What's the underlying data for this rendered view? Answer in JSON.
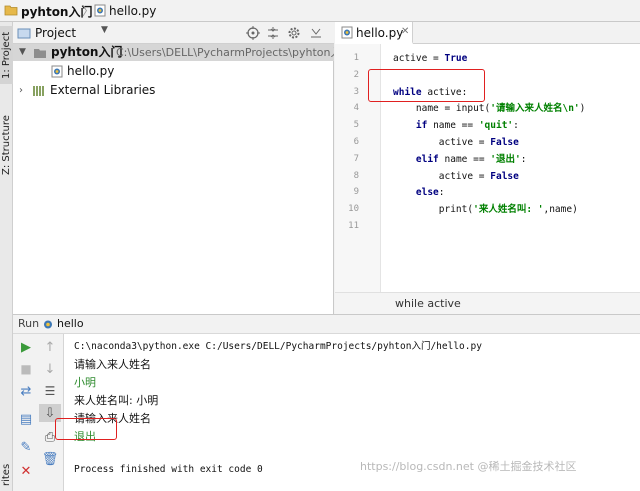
{
  "nav": {
    "project": "pyhton入门",
    "file": "hello.py"
  },
  "side_tabs": {
    "project": "1: Project",
    "structure": "Z: Structure",
    "favorites": "rites"
  },
  "project_panel": {
    "title": "Project",
    "root": {
      "name": "pyhton入门",
      "path": "C:\\Users\\DELL\\PycharmProjects\\pyhton入门"
    },
    "file": "hello.py",
    "external": "External Libraries"
  },
  "editor": {
    "tab": "hello.py",
    "lines": [
      {
        "n": "1",
        "indent": "",
        "parts": [
          {
            "t": "active = ",
            "c": ""
          },
          {
            "t": "True",
            "c": "kw"
          }
        ]
      },
      {
        "n": "2",
        "indent": "",
        "parts": []
      },
      {
        "n": "3",
        "indent": "",
        "parts": [
          {
            "t": "while",
            "c": "kw"
          },
          {
            "t": " active:",
            "c": ""
          }
        ]
      },
      {
        "n": "4",
        "indent": "    ",
        "parts": [
          {
            "t": "name = input(",
            "c": ""
          },
          {
            "t": "'请输入来人姓名\\n'",
            "c": "str"
          },
          {
            "t": ")",
            "c": ""
          }
        ]
      },
      {
        "n": "5",
        "indent": "    ",
        "parts": [
          {
            "t": "if",
            "c": "kw"
          },
          {
            "t": " name == ",
            "c": ""
          },
          {
            "t": "'quit'",
            "c": "str"
          },
          {
            "t": ":",
            "c": ""
          }
        ]
      },
      {
        "n": "6",
        "indent": "        ",
        "parts": [
          {
            "t": "active = ",
            "c": ""
          },
          {
            "t": "False",
            "c": "kw"
          }
        ]
      },
      {
        "n": "7",
        "indent": "    ",
        "parts": [
          {
            "t": "elif",
            "c": "kw"
          },
          {
            "t": " name == ",
            "c": ""
          },
          {
            "t": "'退出'",
            "c": "str"
          },
          {
            "t": ":",
            "c": ""
          }
        ]
      },
      {
        "n": "8",
        "indent": "        ",
        "parts": [
          {
            "t": "active = ",
            "c": ""
          },
          {
            "t": "False",
            "c": "kw"
          }
        ]
      },
      {
        "n": "9",
        "indent": "    ",
        "parts": [
          {
            "t": "else",
            "c": "kw"
          },
          {
            "t": ":",
            "c": ""
          }
        ]
      },
      {
        "n": "10",
        "indent": "        ",
        "parts": [
          {
            "t": "print(",
            "c": ""
          },
          {
            "t": "'来人姓名叫: '",
            "c": "str"
          },
          {
            "t": ",name)",
            "c": ""
          }
        ]
      },
      {
        "n": "11",
        "indent": "",
        "parts": []
      }
    ],
    "breadcrumb": "while active"
  },
  "run": {
    "label": "Run",
    "config": "hello",
    "console": [
      {
        "text": "C:\\naconda3\\python.exe C:/Users/DELL/PycharmProjects/pyhton入门/hello.py",
        "color": "#111111",
        "mono": true
      },
      {
        "text": "请输入来人姓名",
        "color": "#111111",
        "mono": false
      },
      {
        "text": "小明",
        "color": "#2e8b2e",
        "mono": false
      },
      {
        "text": "来人姓名叫:  小明",
        "color": "#111111",
        "mono": false
      },
      {
        "text": "请输入来人姓名",
        "color": "#111111",
        "mono": false
      },
      {
        "text": "退出",
        "color": "#2e8b2e",
        "mono": false
      },
      {
        "text": "",
        "color": "#111111",
        "mono": false
      },
      {
        "text": "Process finished with exit code 0",
        "color": "#111111",
        "mono": true
      }
    ]
  },
  "watermark": "https://blog.csdn.net @稀土掘金技术社区",
  "colors": {
    "accent_red": "#e02020",
    "keyword": "#000080",
    "string": "#008000"
  }
}
